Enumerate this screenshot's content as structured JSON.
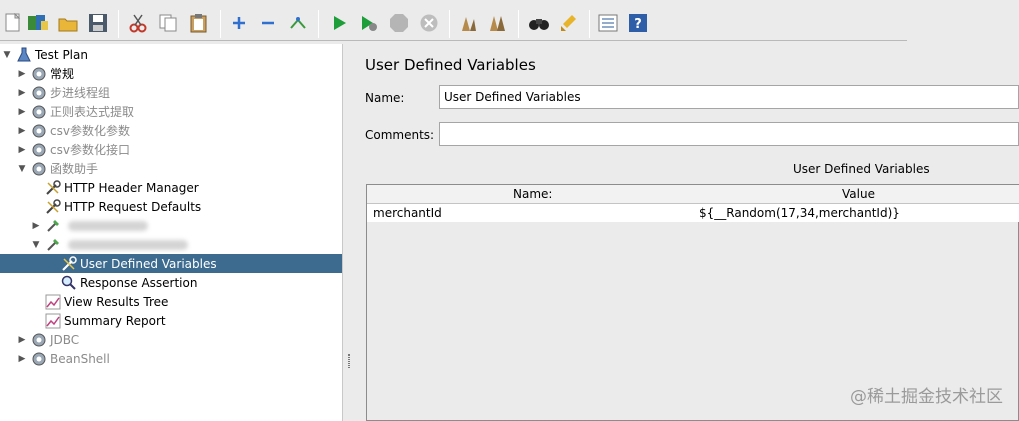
{
  "toolbar": {
    "buttons": [
      {
        "name": "new-icon"
      },
      {
        "name": "templates-icon"
      },
      {
        "name": "open-icon"
      },
      {
        "name": "save-icon"
      },
      {
        "name": "cut-icon"
      },
      {
        "name": "copy-icon"
      },
      {
        "name": "paste-icon"
      },
      {
        "name": "expand-icon"
      },
      {
        "name": "collapse-icon"
      },
      {
        "name": "toggle-icon"
      },
      {
        "name": "start-icon"
      },
      {
        "name": "start-no-pause-icon"
      },
      {
        "name": "stop-icon"
      },
      {
        "name": "shutdown-icon"
      },
      {
        "name": "clear-icon"
      },
      {
        "name": "clear-all-icon"
      },
      {
        "name": "search-icon"
      },
      {
        "name": "reset-search-icon"
      },
      {
        "name": "function-helper-icon"
      },
      {
        "name": "help-icon"
      }
    ]
  },
  "tree": {
    "items": [
      {
        "label": "Test Plan"
      },
      {
        "label": "常规"
      },
      {
        "label": "步进线程组"
      },
      {
        "label": "正则表达式提取"
      },
      {
        "label": "csv参数化参数"
      },
      {
        "label": "csv参数化接口"
      },
      {
        "label": "函数助手"
      },
      {
        "label": "HTTP Header Manager"
      },
      {
        "label": "HTTP Request Defaults"
      },
      {
        "label": ""
      },
      {
        "label": ""
      },
      {
        "label": "User Defined Variables"
      },
      {
        "label": "Response Assertion"
      },
      {
        "label": "View Results Tree"
      },
      {
        "label": "Summary Report"
      },
      {
        "label": "JDBC"
      },
      {
        "label": "BeanShell"
      }
    ]
  },
  "panel": {
    "title": "User Defined Variables",
    "name_label": "Name:",
    "name_value": "User Defined Variables",
    "comments_label": "Comments:",
    "comments_value": "",
    "section_title": "User Defined Variables",
    "table": {
      "columns": [
        "Name:",
        "Value"
      ],
      "rows": [
        {
          "name": "merchantId",
          "value": "${__Random(17,34,merchantId)}"
        }
      ]
    }
  },
  "watermark": "@稀土掘金技术社区"
}
